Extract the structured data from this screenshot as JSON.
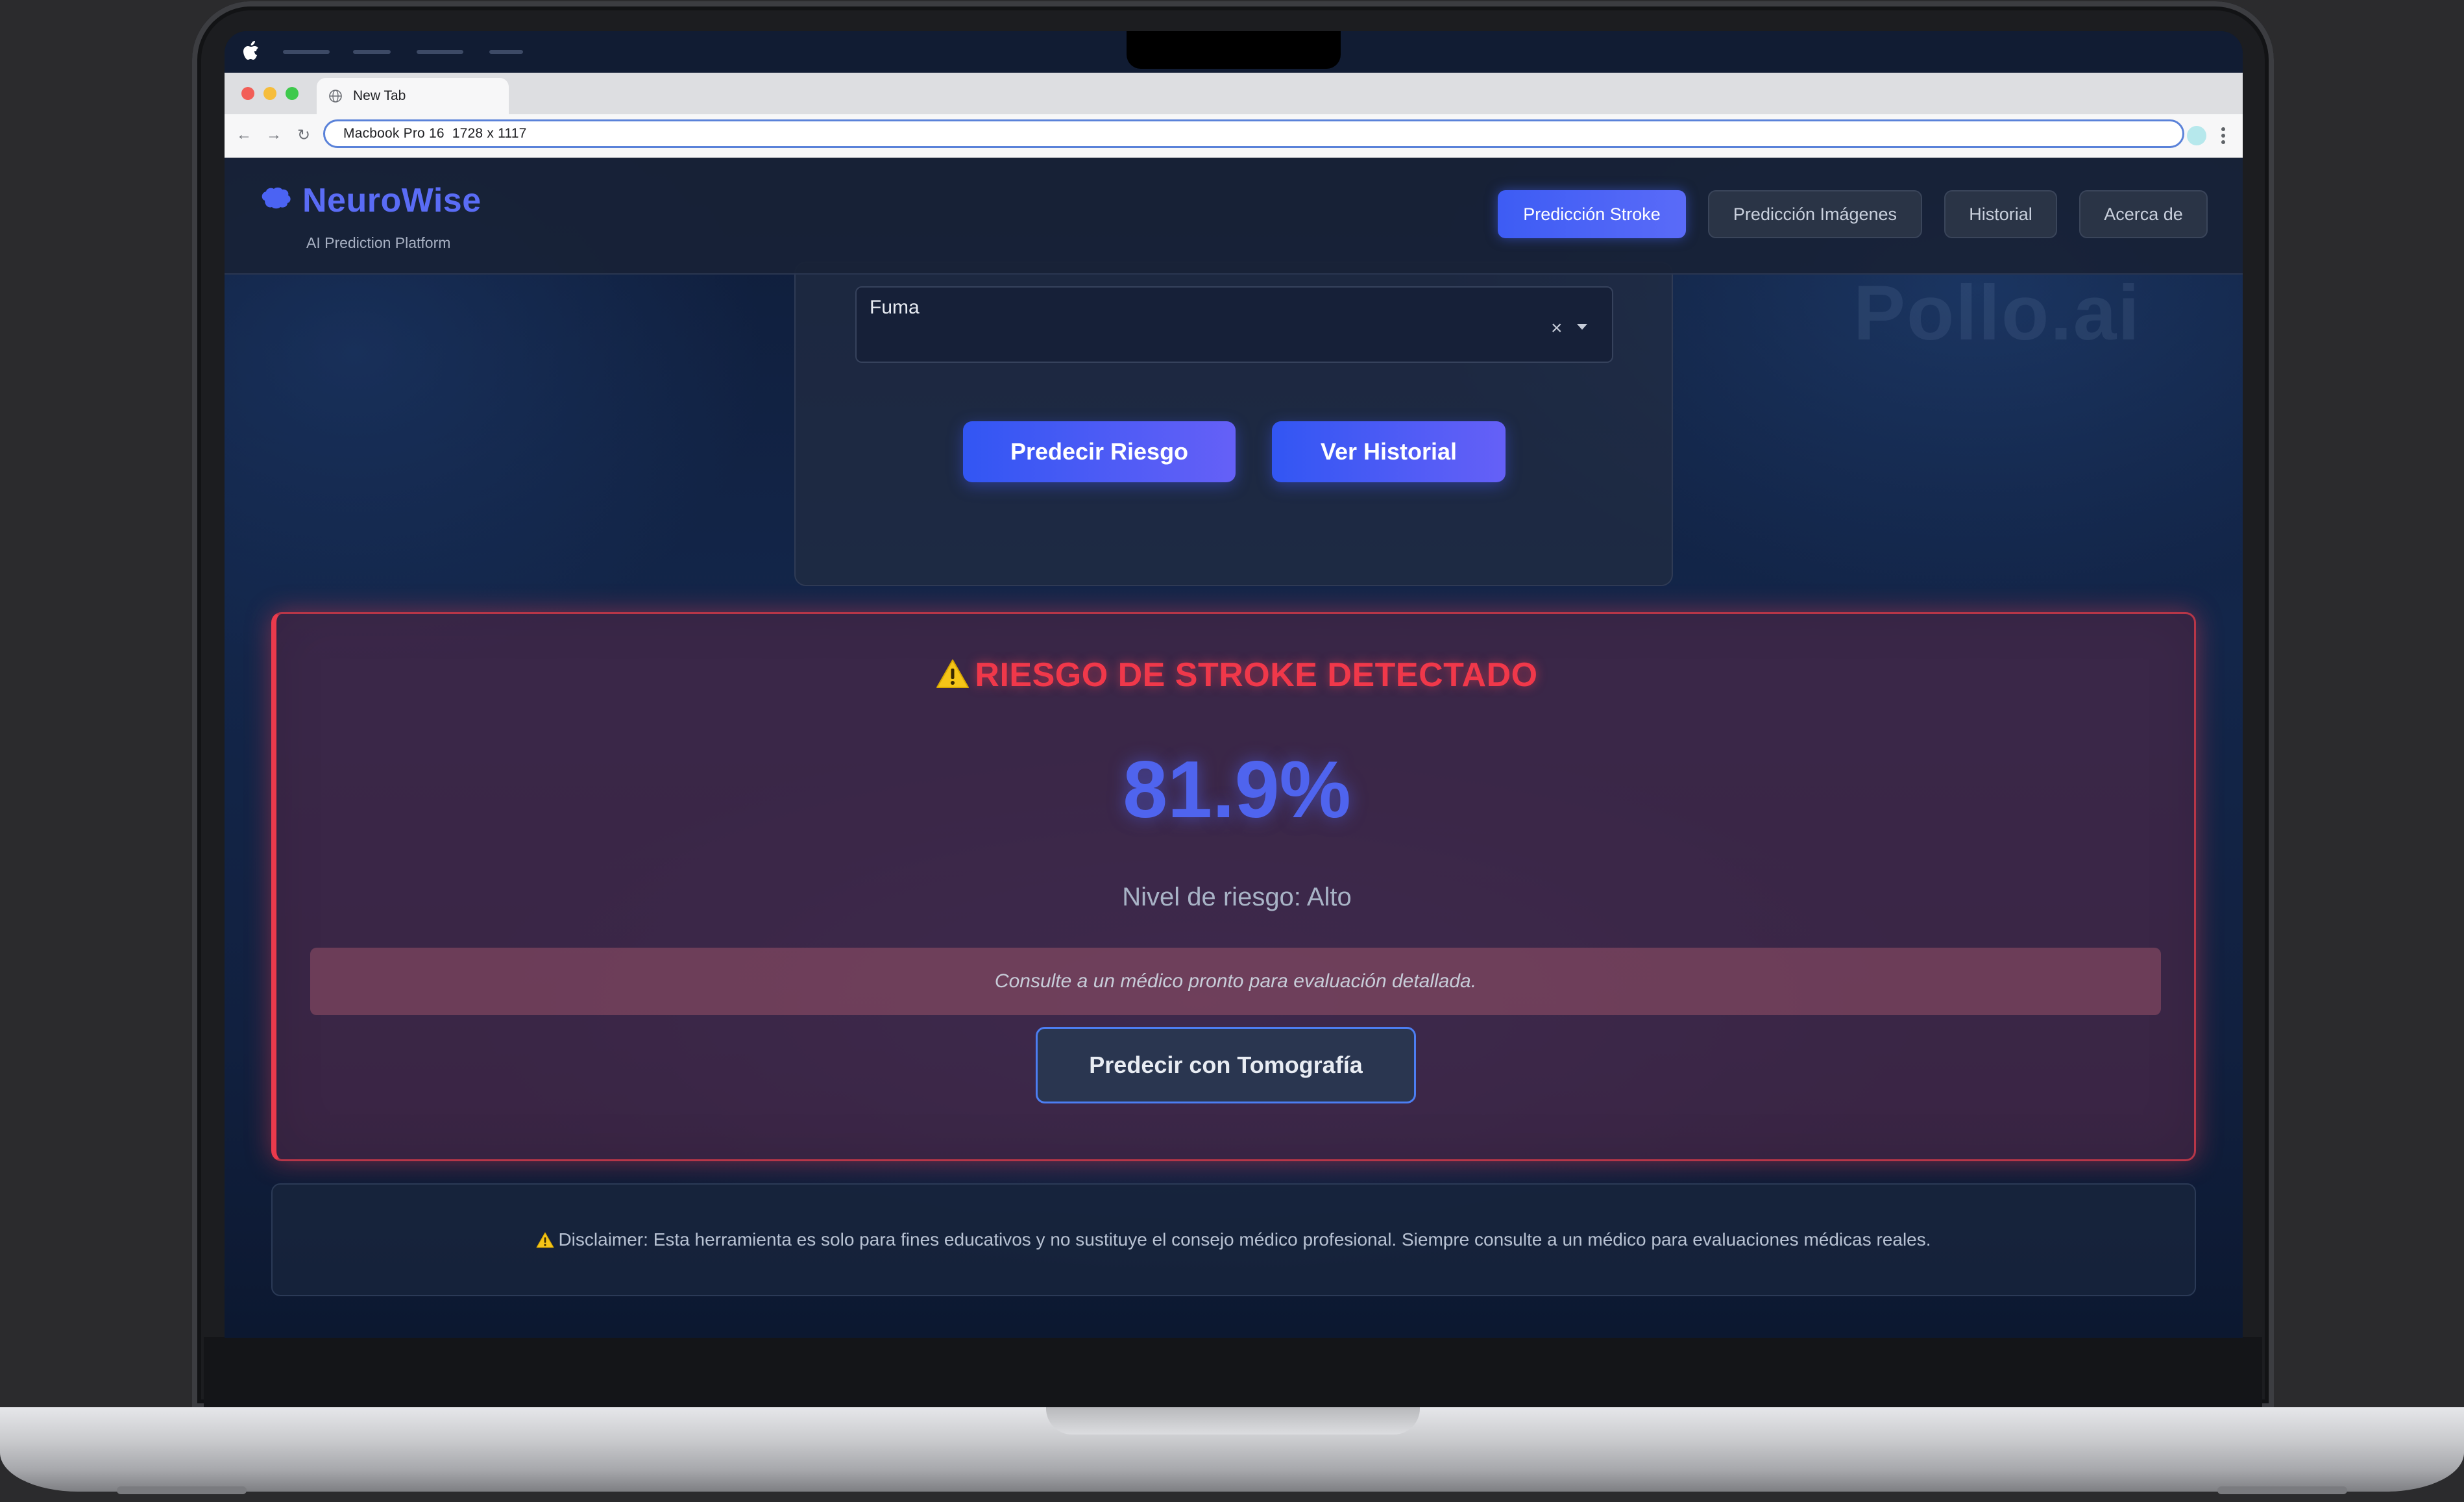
{
  "browser": {
    "tab_title": "New Tab",
    "address": "Macbook Pro 16  1728 x 1117"
  },
  "app": {
    "brand_name": "NeuroWise",
    "brand_subtitle": "AI Prediction Platform",
    "nav": [
      {
        "label": "Predicción Stroke",
        "active": true
      },
      {
        "label": "Predicción Imágenes",
        "active": false
      },
      {
        "label": "Historial",
        "active": false
      },
      {
        "label": "Acerca de",
        "active": false
      }
    ],
    "watermark": "Pollo.ai"
  },
  "form": {
    "smoking_field_value": "Fuma",
    "clear_symbol": "×",
    "predict_button": "Predecir Riesgo",
    "history_button": "Ver Historial"
  },
  "result": {
    "title": "RIESGO DE STROKE DETECTADO",
    "probability": "81.9%",
    "risk_level": "Nivel de riesgo: Alto",
    "advice": "Consulte a un médico pronto para evaluación detallada.",
    "tomography_button": "Predecir con Tomografía"
  },
  "disclaimer": {
    "text": "Disclaimer: Esta herramienta es solo para fines educativos y no sustituye el consejo médico profesional. Siempre consulte a un médico para evaluaciones médicas reales."
  },
  "colors": {
    "accent": "#4f64ee",
    "danger": "#ea3a4c",
    "warning": "#f5c518",
    "background": "#0f1d3a"
  },
  "icons": [
    "apple-icon",
    "globe-icon",
    "back-arrow-icon",
    "forward-arrow-icon",
    "reload-icon",
    "kebab-icon",
    "brain-icon",
    "warning-icon",
    "clear-icon",
    "caret-down-icon"
  ]
}
